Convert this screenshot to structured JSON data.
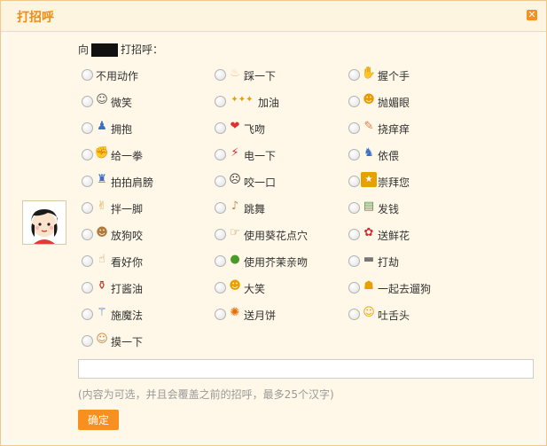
{
  "dialog": {
    "title": "打招呼",
    "close_icon": "close-icon"
  },
  "greeting": {
    "prefix": "向",
    "suffix": "打招呼："
  },
  "options": [
    {
      "label": "不用动作",
      "icon": "none"
    },
    {
      "label": "踩一下",
      "icon": "foot-icon"
    },
    {
      "label": "握个手",
      "icon": "handshake-icon"
    },
    {
      "label": "微笑",
      "icon": "smile-icon"
    },
    {
      "label": "加油",
      "icon": "cheer-icon"
    },
    {
      "label": "抛媚眼",
      "icon": "wink-icon"
    },
    {
      "label": "拥抱",
      "icon": "hug-icon"
    },
    {
      "label": "飞吻",
      "icon": "kiss-icon"
    },
    {
      "label": "挠痒痒",
      "icon": "tickle-icon"
    },
    {
      "label": "给一拳",
      "icon": "punch-icon"
    },
    {
      "label": "电一下",
      "icon": "lightning-icon"
    },
    {
      "label": "依偎",
      "icon": "cuddle-icon"
    },
    {
      "label": "拍拍肩膀",
      "icon": "pat-icon"
    },
    {
      "label": "咬一口",
      "icon": "bite-icon"
    },
    {
      "label": "崇拜您",
      "icon": "worship-icon"
    },
    {
      "label": "拌一脚",
      "icon": "trip-icon"
    },
    {
      "label": "跳舞",
      "icon": "dance-icon"
    },
    {
      "label": "发钱",
      "icon": "money-icon"
    },
    {
      "label": "放狗咬",
      "icon": "dog-icon"
    },
    {
      "label": "使用葵花点穴",
      "icon": "point-finger-icon"
    },
    {
      "label": "送鲜花",
      "icon": "flower-icon"
    },
    {
      "label": "看好你",
      "icon": "thumbs-up-icon"
    },
    {
      "label": "使用芥茉亲吻",
      "icon": "wasabi-kiss-icon"
    },
    {
      "label": "打劫",
      "icon": "gun-icon"
    },
    {
      "label": "打酱油",
      "icon": "soy-sauce-icon"
    },
    {
      "label": "大笑",
      "icon": "laugh-icon"
    },
    {
      "label": "一起去遛狗",
      "icon": "walk-dog-icon"
    },
    {
      "label": "施魔法",
      "icon": "magic-wand-icon"
    },
    {
      "label": "送月饼",
      "icon": "mooncake-icon"
    },
    {
      "label": "吐舌头",
      "icon": "tongue-icon"
    },
    {
      "label": "摸一下",
      "icon": "touch-icon"
    }
  ],
  "message": {
    "value": "",
    "hint": "(内容为可选，并且会覆盖之前的招呼，最多25个汉字)"
  },
  "confirm_label": "确定",
  "colors": {
    "accent": "#f7901e",
    "title": "#f48c0c",
    "panel_bg": "#fff8e8"
  }
}
